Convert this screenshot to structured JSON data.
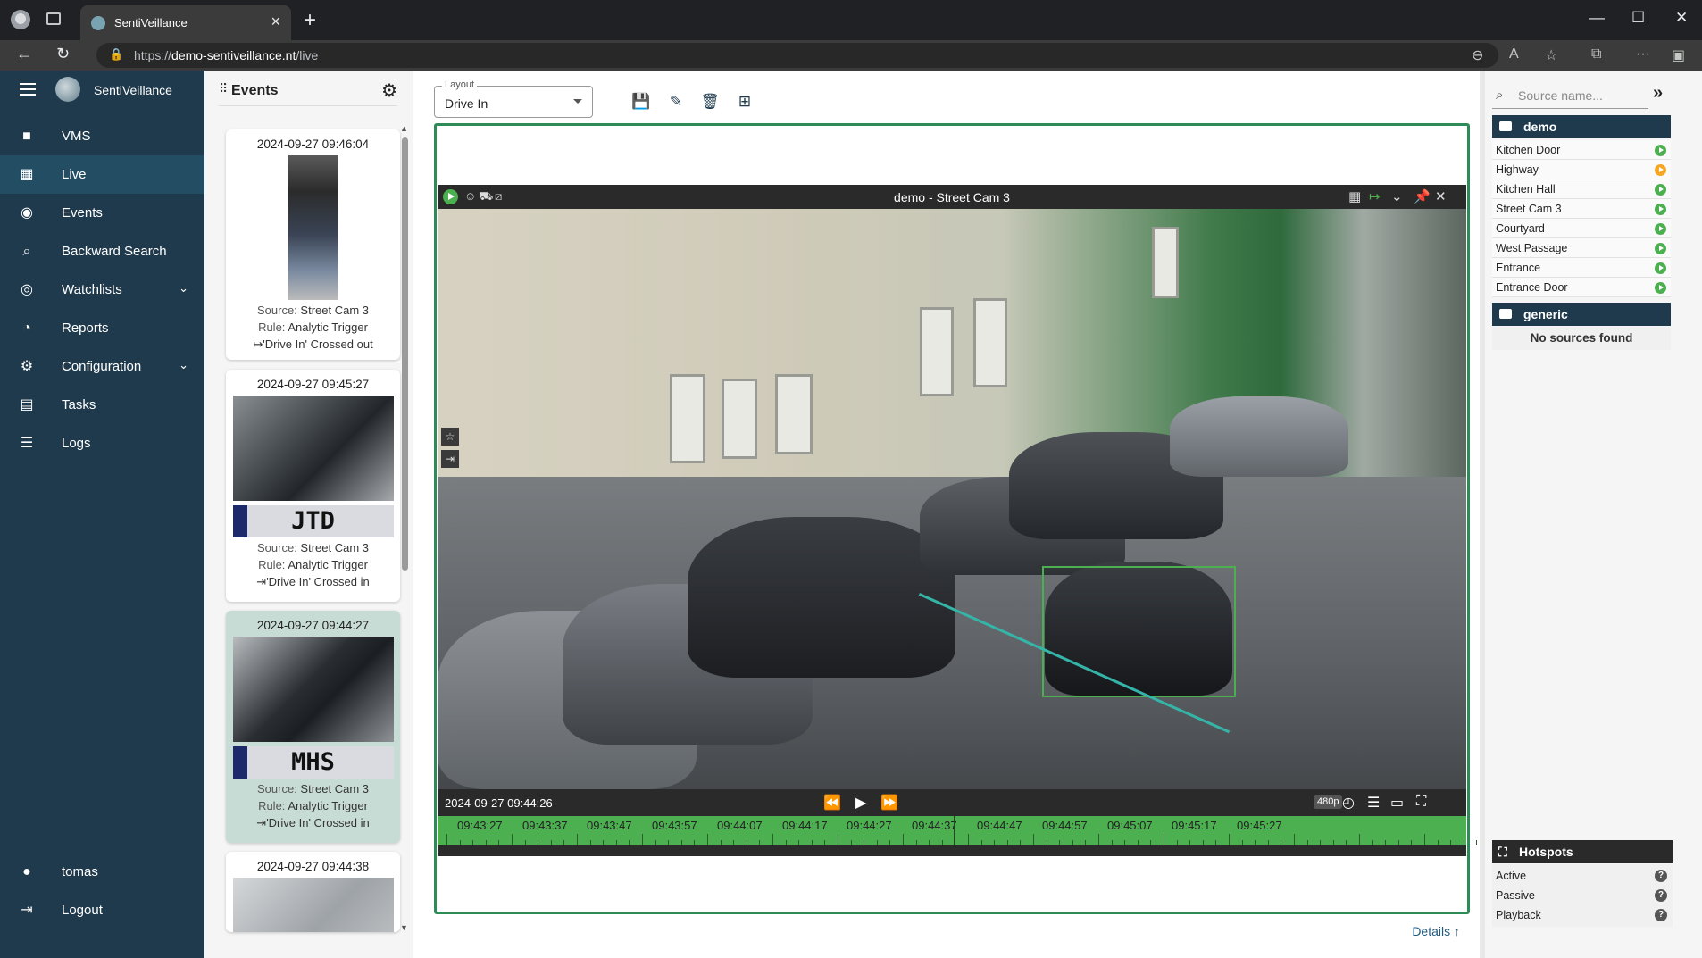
{
  "browser": {
    "tab_title": "SentiVeillance",
    "url_prefix": "https://",
    "url_host": "demo-sentiveillance.nt",
    "url_path": "/live"
  },
  "app": {
    "brand": "SentiVeillance"
  },
  "sidebar": {
    "items": [
      {
        "label": "VMS",
        "icon": "video-camera-icon"
      },
      {
        "label": "Live",
        "icon": "dashboard-icon",
        "active": true
      },
      {
        "label": "Events",
        "icon": "aperture-icon"
      },
      {
        "label": "Backward Search",
        "icon": "search-icon"
      },
      {
        "label": "Watchlists",
        "icon": "eye-icon",
        "expandable": true
      },
      {
        "label": "Reports",
        "icon": "pie-chart-icon"
      },
      {
        "label": "Configuration",
        "icon": "gear-icon",
        "expandable": true
      },
      {
        "label": "Tasks",
        "icon": "clipboard-icon"
      },
      {
        "label": "Logs",
        "icon": "list-icon"
      }
    ],
    "user": "tomas",
    "logout": "Logout"
  },
  "events": {
    "title": "Events",
    "source_label": "Source:",
    "rule_label": "Rule:",
    "cards": [
      {
        "time": "2024-09-27 09:46:04",
        "source": "Street Cam 3",
        "rule": "Analytic Trigger",
        "action": "'Drive In' Crossed out",
        "action_icon": "↦",
        "kind": "person"
      },
      {
        "time": "2024-09-27 09:45:27",
        "source": "Street Cam 3",
        "rule": "Analytic Trigger",
        "action": "'Drive In' Crossed in",
        "action_icon": "⇥",
        "kind": "car",
        "plate": "JTD"
      },
      {
        "time": "2024-09-27 09:44:27",
        "source": "Street Cam 3",
        "rule": "Analytic Trigger",
        "action": "'Drive In' Crossed in",
        "action_icon": "⇥",
        "kind": "car",
        "plate": "MHS",
        "selected": true
      },
      {
        "time": "2024-09-27 09:44:38",
        "kind": "car"
      }
    ]
  },
  "layout": {
    "label": "Layout",
    "value": "Drive In"
  },
  "camera": {
    "title": "demo - Street Cam 3",
    "timestamp": "2024-09-27 09:44:26",
    "quality": "480p",
    "timeline_ticks": [
      "09:43:27",
      "09:43:37",
      "09:43:47",
      "09:43:57",
      "09:44:07",
      "09:44:17",
      "09:44:27",
      "09:44:37",
      "09:44:47",
      "09:44:57",
      "09:45:07",
      "09:45:17",
      "09:45:27"
    ],
    "colors": {
      "accent": "#4caf50",
      "lane": "#35b5a8"
    }
  },
  "details_link": "Details",
  "sources": {
    "search_placeholder": "Source name...",
    "groups": [
      {
        "name": "demo",
        "items": [
          {
            "name": "Kitchen Door",
            "status": "playing",
            "color": "#4caf50"
          },
          {
            "name": "Highway",
            "status": "paused",
            "color": "#f5a623"
          },
          {
            "name": "Kitchen Hall",
            "status": "playing",
            "color": "#4caf50"
          },
          {
            "name": "Street Cam 3",
            "status": "playing",
            "color": "#4caf50"
          },
          {
            "name": "Courtyard",
            "status": "playing",
            "color": "#4caf50"
          },
          {
            "name": "West Passage",
            "status": "playing",
            "color": "#4caf50"
          },
          {
            "name": "Entrance",
            "status": "playing",
            "color": "#4caf50"
          },
          {
            "name": "Entrance Door",
            "status": "playing",
            "color": "#4caf50"
          }
        ]
      },
      {
        "name": "generic",
        "empty_text": "No sources found"
      }
    ]
  },
  "hotspots": {
    "title": "Hotspots",
    "items": [
      "Active",
      "Passive",
      "Playback"
    ]
  }
}
